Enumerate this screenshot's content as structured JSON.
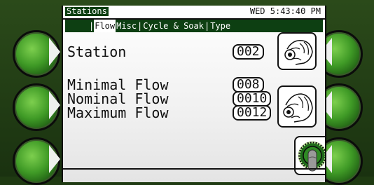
{
  "header": {
    "title": "Stations",
    "clock": "WED 5:43:40 PM"
  },
  "tabs": [
    {
      "label": "Flow",
      "active": true
    },
    {
      "label": "Misc",
      "active": false
    },
    {
      "label": "Cycle & Soak",
      "active": false
    },
    {
      "label": "Type",
      "active": false
    }
  ],
  "fields": {
    "station": {
      "label": "Station",
      "value": "002"
    },
    "minimal_flow": {
      "label": "Minimal Flow",
      "value": "008"
    },
    "nominal_flow": {
      "label": "Nominal Flow",
      "value": "0010"
    },
    "maximum_flow": {
      "label": "Maximum Flow",
      "value": "0012"
    }
  },
  "icons": {
    "station_adjust": "hand-turning-knob-icon",
    "flow_adjust": "hand-turning-knob-icon",
    "select": "rotary-knob-icon"
  },
  "colors": {
    "tab_bar": "#0d3f12",
    "screen_bg": "#ffffff",
    "softkey": "#3f9a26"
  }
}
